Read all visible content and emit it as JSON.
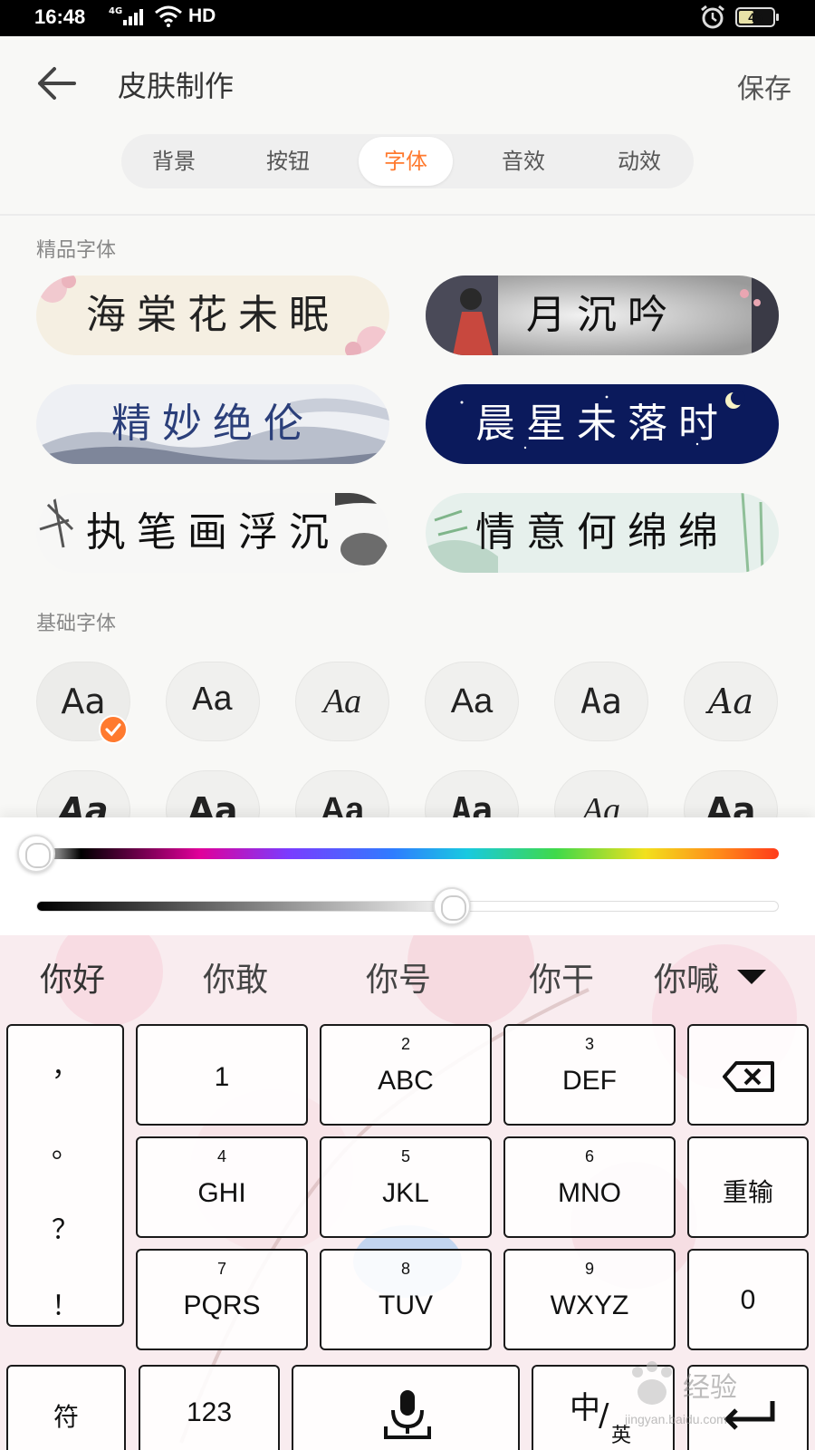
{
  "status_bar": {
    "time": "16:48",
    "network": "4G",
    "hd": "HD",
    "battery": "45",
    "battery_level": 0.45
  },
  "header": {
    "title": "皮肤制作",
    "save_label": "保存"
  },
  "tabs": [
    {
      "label": "背景"
    },
    {
      "label": "按钮"
    },
    {
      "label": "字体",
      "active": true
    },
    {
      "label": "音效"
    },
    {
      "label": "动效"
    }
  ],
  "premium_section": {
    "label": "精品字体"
  },
  "premium_fonts": [
    {
      "text": "海棠花未眠"
    },
    {
      "text": "月沉吟"
    },
    {
      "text": "精妙绝伦"
    },
    {
      "text": "晨星未落时"
    },
    {
      "text": "执笔画浮沉"
    },
    {
      "text": "情意何绵绵"
    }
  ],
  "basic_section": {
    "label": "基础字体"
  },
  "basic_fonts": [
    {
      "text": "Aa",
      "selected": true
    },
    {
      "text": "Aa"
    },
    {
      "text": "Aa"
    },
    {
      "text": "Aa"
    },
    {
      "text": "Aa"
    },
    {
      "text": "Aa"
    },
    {
      "text": "Aa"
    },
    {
      "text": "Aa"
    },
    {
      "text": "Aa"
    },
    {
      "text": "Aa"
    },
    {
      "text": "Aa"
    },
    {
      "text": "Aa"
    }
  ],
  "color_panel": {
    "hue_value": 0.0,
    "brightness_value": 0.56
  },
  "keyboard": {
    "candidates": [
      "你好",
      "你敢",
      "你号",
      "你干",
      "你喊"
    ],
    "punctuation": [
      "，",
      "。",
      "？",
      "！"
    ],
    "keys": {
      "k1": {
        "num": "",
        "letters": "1"
      },
      "k2": {
        "num": "2",
        "letters": "ABC"
      },
      "k3": {
        "num": "3",
        "letters": "DEF"
      },
      "k4": {
        "num": "4",
        "letters": "GHI"
      },
      "k5": {
        "num": "5",
        "letters": "JKL"
      },
      "k6": {
        "num": "6",
        "letters": "MNO"
      },
      "k7": {
        "num": "7",
        "letters": "PQRS"
      },
      "k8": {
        "num": "8",
        "letters": "TUV"
      },
      "k9": {
        "num": "9",
        "letters": "WXYZ"
      }
    },
    "reenter_label": "重输",
    "zero_label": "0",
    "symbol_label": "符",
    "num_label": "123",
    "lang_main": "中",
    "lang_sub": "英"
  },
  "watermark": {
    "text": "经验",
    "sub": "jingyan.baidu.com"
  },
  "colors": {
    "accent": "#ff7a2f",
    "tab_bg": "#efefef",
    "night": "#0b1a5c"
  }
}
